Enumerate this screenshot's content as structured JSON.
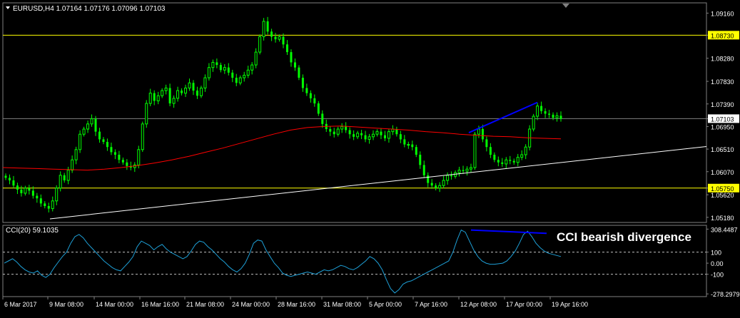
{
  "chart_data": [
    {
      "type": "candlestick",
      "symbol_info": {
        "header": "EURUSD,H4",
        "open": "1.07164",
        "high": "1.07176",
        "low": "1.07096",
        "close": "1.07103"
      },
      "ylim": [
        1.0508,
        1.0936
      ],
      "y_ticks": [
        "1.09160",
        "1.08730",
        "1.08280",
        "1.07830",
        "1.07390",
        "1.07103",
        "1.06950",
        "1.06510",
        "1.06070",
        "1.05750",
        "1.05620",
        "1.05180"
      ],
      "price_levels": [
        {
          "label": "1.08730",
          "value": 1.0873,
          "color": "#ffff00"
        },
        {
          "label": "1.05750",
          "value": 1.0575,
          "color": "#ffff00"
        }
      ],
      "current_price": {
        "label": "1.07103",
        "value": 1.07103,
        "color": "#c0c0c0"
      },
      "candle_closes": [
        1.0595,
        1.059,
        1.058,
        1.0572,
        1.0565,
        1.0575,
        1.057,
        1.056,
        1.0555,
        1.0545,
        1.054,
        1.0535,
        1.055,
        1.0575,
        1.06,
        1.059,
        1.061,
        1.063,
        1.065,
        1.068,
        1.069,
        1.07,
        1.071,
        1.0685,
        1.067,
        1.0665,
        1.0655,
        1.0645,
        1.064,
        1.063,
        1.0625,
        1.0618,
        1.0615,
        1.062,
        1.065,
        1.07,
        1.074,
        1.076,
        1.0745,
        1.0755,
        1.0765,
        1.077,
        1.074,
        1.075,
        1.0765,
        1.076,
        1.077,
        1.078,
        1.0765,
        1.0755,
        1.077,
        1.079,
        1.081,
        1.082,
        1.0815,
        1.0805,
        1.081,
        1.08,
        1.079,
        1.078,
        1.079,
        1.0795,
        1.0805,
        1.0815,
        1.084,
        1.087,
        1.09,
        1.088,
        1.087,
        1.0865,
        1.087,
        1.0855,
        1.084,
        1.082,
        1.081,
        1.079,
        1.077,
        1.076,
        1.075,
        1.074,
        1.072,
        1.07,
        1.069,
        1.0685,
        1.068,
        1.069,
        1.0695,
        1.0688,
        1.068,
        1.0675,
        1.0682,
        1.0678,
        1.067,
        1.0675,
        1.068,
        1.0685,
        1.0678,
        1.0672,
        1.0685,
        1.069,
        1.068,
        1.067,
        1.066,
        1.066,
        1.0655,
        1.064,
        1.062,
        1.06,
        1.0585,
        1.058,
        1.0575,
        1.058,
        1.059,
        1.06,
        1.0598,
        1.0605,
        1.061,
        1.0608,
        1.0612,
        1.0615,
        1.068,
        1.069,
        1.067,
        1.0655,
        1.064,
        1.063,
        1.0625,
        1.0622,
        1.063,
        1.0628,
        1.0625,
        1.0635,
        1.064,
        1.0655,
        1.069,
        1.0715,
        1.0735,
        1.0725,
        1.072,
        1.0718,
        1.0712,
        1.0716,
        1.071
      ],
      "moving_average": [
        1.0615,
        1.0614,
        1.0613,
        1.0612,
        1.0611,
        1.061,
        1.0612,
        1.0615,
        1.0619,
        1.0624,
        1.063,
        1.0637,
        1.0645,
        1.0653,
        1.0662,
        1.0671,
        1.068,
        1.0688,
        1.0693,
        1.0695,
        1.0696,
        1.0694,
        1.0692,
        1.069,
        1.0688,
        1.0685,
        1.0683,
        1.068,
        1.0678,
        1.0676,
        1.0675,
        1.0673,
        1.0672,
        1.0671
      ],
      "support_line": {
        "from": 1.0515,
        "to": 1.0656,
        "color": "#ffffff"
      },
      "divergence_line_price": {
        "from": 1.0683,
        "to": 1.0742,
        "color": "#0000ff"
      },
      "x_tick_labels": [
        "6 Mar 2017",
        "9 Mar 08:00",
        "14 Mar 00:00",
        "16 Mar 16:00",
        "21 Mar 08:00",
        "24 Mar 00:00",
        "28 Mar 16:00",
        "31 Mar 08:00",
        "5 Apr 00:00",
        "7 Apr 16:00",
        "12 Apr 08:00",
        "17 Apr 00:00",
        "19 Apr 16:00"
      ]
    },
    {
      "type": "line",
      "indicator_label": "CCI(20) 59.1035",
      "ylim": [
        -290,
        330
      ],
      "y_ticks": [
        "308.4487",
        "100",
        "0.00",
        "-100",
        "-278.2979"
      ],
      "levels": [
        100,
        -100
      ],
      "values": [
        0,
        20,
        40,
        10,
        -30,
        -60,
        -80,
        -90,
        -70,
        -110,
        -130,
        -100,
        -40,
        10,
        60,
        100,
        180,
        240,
        260,
        230,
        180,
        140,
        100,
        60,
        20,
        -10,
        -40,
        -60,
        -70,
        -30,
        10,
        60,
        150,
        200,
        180,
        160,
        120,
        150,
        170,
        130,
        100,
        80,
        60,
        40,
        60,
        110,
        170,
        200,
        190,
        150,
        120,
        80,
        40,
        10,
        -30,
        -60,
        -80,
        -50,
        0,
        80,
        180,
        210,
        200,
        120,
        60,
        0,
        -40,
        -90,
        -110,
        -120,
        -110,
        -100,
        -90,
        -80,
        -90,
        -100,
        -80,
        -60,
        -70,
        -60,
        -40,
        -20,
        -30,
        -50,
        -60,
        -40,
        -10,
        20,
        60,
        40,
        0,
        -60,
        -150,
        -230,
        -270,
        -240,
        -190,
        -170,
        -160,
        -140,
        -120,
        -100,
        -80,
        -60,
        -40,
        -20,
        0,
        20,
        100,
        210,
        300,
        280,
        200,
        120,
        60,
        20,
        0,
        -10,
        -10,
        -5,
        0,
        20,
        60,
        110,
        180,
        260,
        290,
        240,
        180,
        140,
        110,
        90,
        80,
        70,
        60
      ],
      "divergence_line_cci": {
        "from": 300,
        "to": 270,
        "color": "#0000ff"
      },
      "annotation": "CCI bearish divergence"
    }
  ]
}
